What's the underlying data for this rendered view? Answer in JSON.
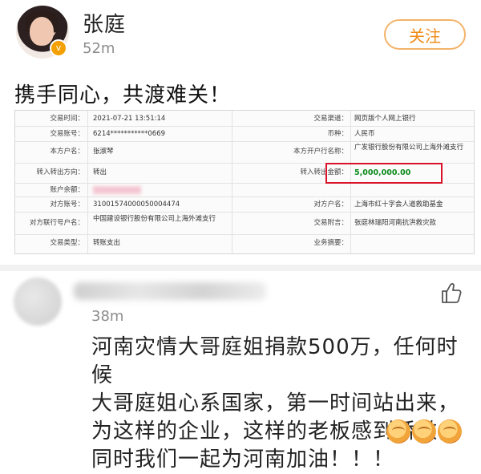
{
  "post": {
    "user_name": "张庭",
    "time": "52m",
    "follow_label": "关注",
    "text": "携手同心，共渡难关！"
  },
  "receipt": {
    "rows": [
      {
        "l1": "交易时间：",
        "v1": "2021-07-21 13:51:14",
        "l2": "交易渠道：",
        "v2": "网页版个人网上银行"
      },
      {
        "l1": "交易账号：",
        "v1": "6214***********0669",
        "l2": "币种：",
        "v2": "人民币"
      },
      {
        "l1": "本方户名：",
        "v1": "张淑琴",
        "l2": "本方开户行名称：",
        "v2": "广发银行股份有限公司上海外滩支行"
      },
      {
        "l1": "转入转出方向：",
        "v1": "转出",
        "l2": "转入转出金额：",
        "v2": "5,000,000.00"
      },
      {
        "l1": "账户余额：",
        "v1": "",
        "l2": "",
        "v2": ""
      },
      {
        "l1": "对方账号：",
        "v1": "31001574000050004474",
        "l2": "对方户名：",
        "v2": "上海市红十字会人道救助基金"
      },
      {
        "l1": "对方联行号户名：",
        "v1": "中国建设银行股份有限公司上海外滩支行",
        "l2": "交易附言：",
        "v2": "张庭林瑞阳河南抗洪救灾款"
      },
      {
        "l1": "交易类型：",
        "v1": "转账支出",
        "l2": "业务摘要：",
        "v2": ""
      }
    ]
  },
  "comment": {
    "time": "38m",
    "text": "河南灾情大哥庭姐捐款500万，任何时候\n大哥庭姐心系国家，第一时间站出来，\n为这样的企业，这样的老板感到骄傲，\n同时我们一起为河南加油！！！",
    "emoji": [
      "fist-emoji",
      "fist-emoji",
      "fist-emoji"
    ]
  },
  "colors": {
    "follow": "#f08c1a",
    "amount": "#0a8a1b",
    "highlight_box": "#d8132a"
  }
}
